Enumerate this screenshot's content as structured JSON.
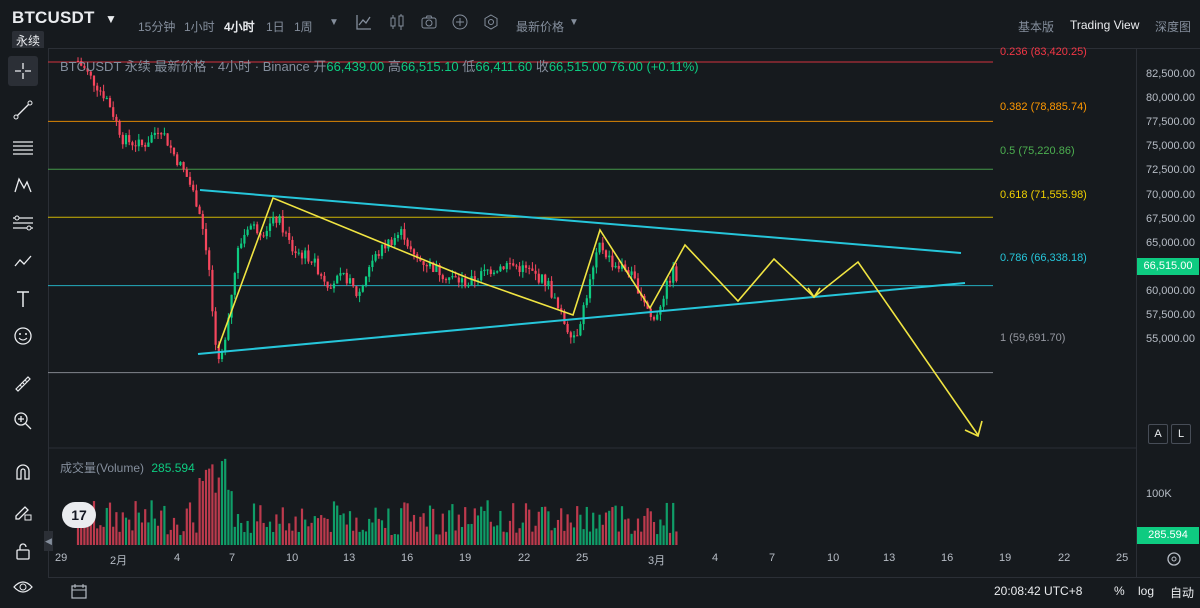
{
  "header": {
    "symbol": "BTCUSDT",
    "perpetual_badge": "永续",
    "timeframes": [
      {
        "label": "15分钟",
        "active": false
      },
      {
        "label": "1小时",
        "active": false
      },
      {
        "label": "4小时",
        "active": true
      },
      {
        "label": "1日",
        "active": false
      },
      {
        "label": "1周",
        "active": false
      }
    ],
    "price_type_label": "最新价格",
    "views": [
      {
        "label": "基本版",
        "active": false
      },
      {
        "label": "Trading View",
        "active": true
      },
      {
        "label": "深度图",
        "active": false
      }
    ]
  },
  "legend": {
    "title": "BTCUSDT 永续 最新价格 · 4小时 · Binance",
    "open_label": "开",
    "open": "66,439.00",
    "high_label": "高",
    "high": "66,515.10",
    "low_label": "低",
    "low": "66,411.60",
    "close_label": "收",
    "close": "66,515.00",
    "change": "76.00 (+0.11%)"
  },
  "fibonacci": [
    {
      "label": "0.236 (83,420.25)",
      "price": 83420.25,
      "color": "#f23645"
    },
    {
      "label": "0.382 (78,885.74)",
      "price": 78885.74,
      "color": "#ff9800"
    },
    {
      "label": "0.5 (75,220.86)",
      "price": 75220.86,
      "color": "#4caf50"
    },
    {
      "label": "0.618 (71,555.98)",
      "price": 71555.98,
      "color": "#f0d000"
    },
    {
      "label": "0.786 (66,338.18)",
      "price": 66338.18,
      "color": "#26c6da"
    },
    {
      "label": "1 (59,691.70)",
      "price": 59691.7,
      "color": "#9598a1"
    }
  ],
  "price_axis": {
    "ticks": [
      "82,500.00",
      "80,000.00",
      "77,500.00",
      "75,000.00",
      "72,500.00",
      "70,000.00",
      "67,500.00",
      "65,000.00",
      "62,500.00",
      "60,000.00",
      "57,500.00",
      "55,000.00"
    ],
    "current_price": "66,515.00",
    "auto_btn": "A",
    "log_btn": "L"
  },
  "volume": {
    "label": "成交量(Volume)",
    "value": "285.594",
    "axis_tick": "100K",
    "current": "285.594"
  },
  "time_axis": {
    "ticks": [
      "29",
      "2月",
      "4",
      "7",
      "10",
      "13",
      "16",
      "19",
      "22",
      "25",
      "3月",
      "4",
      "7",
      "10",
      "13",
      "16",
      "19",
      "22",
      "25"
    ]
  },
  "bottom_bar": {
    "clock": "20:08:42 UTC+8",
    "percent_btn": "%",
    "log_btn": "log",
    "auto_btn": "自动"
  },
  "logo_text": "17",
  "colors": {
    "up": "#0ecb81",
    "down": "#f6465d",
    "trendline": "#26c6da",
    "projection": "#f0e442"
  }
}
